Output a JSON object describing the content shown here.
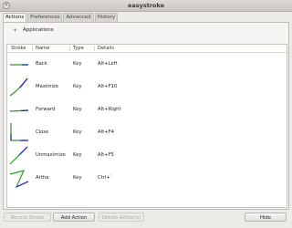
{
  "window": {
    "title": "easystroke",
    "close_glyph": "×"
  },
  "tabs": [
    "Actions",
    "Preferences",
    "Advanced",
    "History"
  ],
  "group": {
    "expander_glyph": "+",
    "label": "Applications"
  },
  "columns": [
    "Stroke",
    "Name",
    "Type",
    "Details"
  ],
  "actions": [
    {
      "name": "Back",
      "type": "Key",
      "details": "Alt+Left",
      "stroke_icon": "horizontal-line-stroke"
    },
    {
      "name": "Maximize",
      "type": "Key",
      "details": "Alt+F10",
      "stroke_icon": "diagonal-up-stroke"
    },
    {
      "name": "Forward",
      "type": "Key",
      "details": "Alt+Right",
      "stroke_icon": "horizontal-line-stroke"
    },
    {
      "name": "Close",
      "type": "Key",
      "details": "Alt+F4",
      "stroke_icon": "down-right-stroke"
    },
    {
      "name": "Unmaximize",
      "type": "Key",
      "details": "Alt+F5",
      "stroke_icon": "diagonal-up-stroke"
    },
    {
      "name": "Artha",
      "type": "Key",
      "details": "Ctrl+`",
      "stroke_icon": "zigzag-stroke"
    }
  ],
  "buttons": {
    "record_stroke": "Record Stroke",
    "add_action": "Add Action",
    "delete_actions": "Delete Action(s)",
    "hide": "Hide"
  },
  "colors": {
    "stroke_start": "#2a9a2a",
    "stroke_end": "#2020c8"
  }
}
